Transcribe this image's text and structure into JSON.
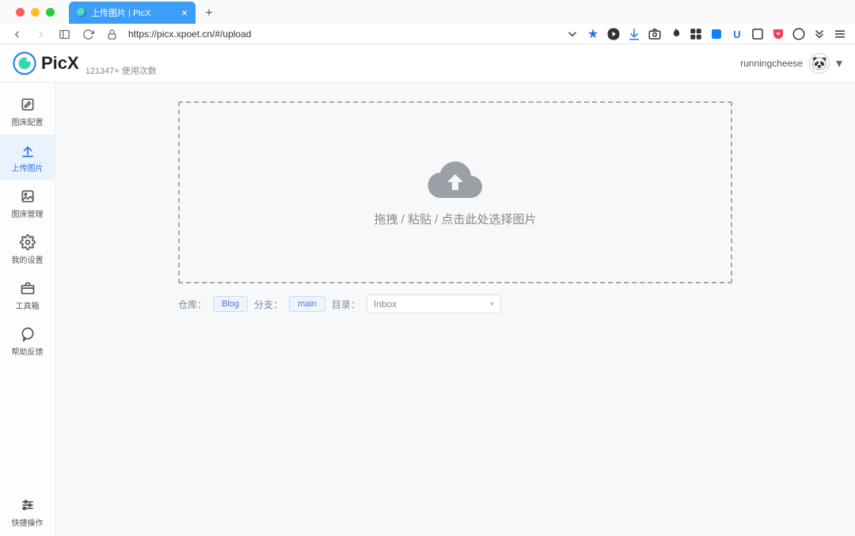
{
  "browser": {
    "tab_title": "上传图片 | PicX",
    "url": "https://picx.xpoet.cn/#/upload"
  },
  "header": {
    "brand": "PicX",
    "usage_count": "121347+ 使用次数",
    "username": "runningcheese"
  },
  "sidebar": {
    "items": [
      {
        "label": "图床配置"
      },
      {
        "label": "上传图片"
      },
      {
        "label": "图床管理"
      },
      {
        "label": "我的设置"
      },
      {
        "label": "工具箱"
      },
      {
        "label": "帮助反馈"
      }
    ],
    "footer_label": "快捷操作"
  },
  "upload": {
    "hint": "拖拽 / 粘贴 / 点击此处选择图片"
  },
  "selectors": {
    "repo_label": "仓库：",
    "repo_value": "Blog",
    "branch_label": "分支：",
    "branch_value": "main",
    "dir_label": "目录：",
    "dir_value": "Inbox"
  }
}
